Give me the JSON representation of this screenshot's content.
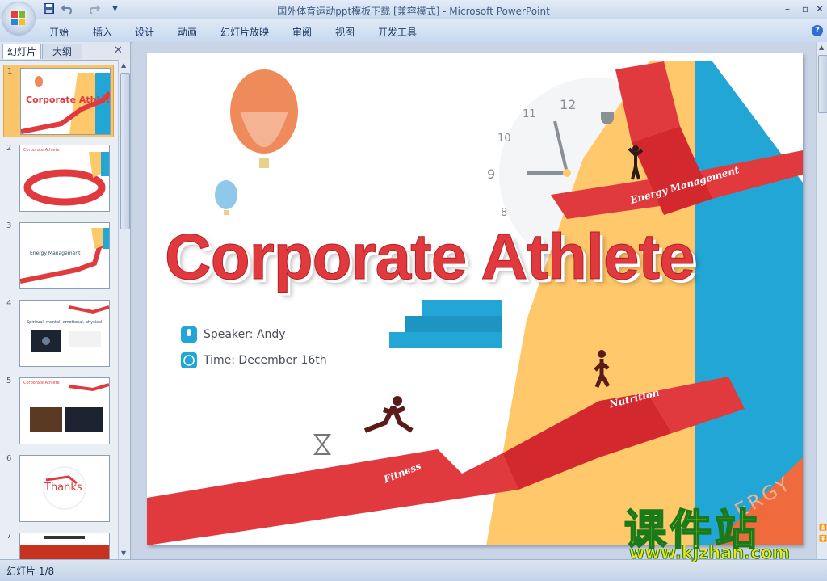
{
  "window": {
    "title": "国外体育运动ppt模板下载 [兼容模式] - Microsoft PowerPoint"
  },
  "quick_access": {
    "save_icon": "save-icon",
    "undo_icon": "undo-icon",
    "redo_icon": "redo-icon",
    "customize_icon": "chevron-down-icon"
  },
  "ribbon": {
    "tabs": [
      "开始",
      "插入",
      "设计",
      "动画",
      "幻灯片放映",
      "审阅",
      "视图",
      "开发工具"
    ],
    "help_label": "?"
  },
  "window_controls": {
    "minimize": "–",
    "restore": "▫",
    "close": "✕"
  },
  "panel": {
    "tabs": [
      "幻灯片",
      "大纲"
    ],
    "close_label": "✕",
    "slides": [
      {
        "number": "1",
        "caption": "Corporate Athlete"
      },
      {
        "number": "2",
        "caption": "Corporate Athlete"
      },
      {
        "number": "3",
        "caption": "Energy Management"
      },
      {
        "number": "4",
        "caption": "Spiritual, mental, emotional, physical"
      },
      {
        "number": "5",
        "caption": "Corporate Athlete"
      },
      {
        "number": "6",
        "caption": "Thanks"
      },
      {
        "number": "7",
        "caption": ""
      }
    ]
  },
  "slide": {
    "title": "Corporate Athlete",
    "speaker": "Speaker:  Andy",
    "time": "Time: December 16th",
    "clock_numbers": [
      "12",
      "11",
      "10",
      "9",
      "8"
    ],
    "labels": {
      "energy": "Energy Management",
      "nutrition": "Nutrition",
      "fitness": "Fitness",
      "corner": "ERGY"
    }
  },
  "status": {
    "text": "幻灯片 1/8"
  },
  "watermark": {
    "big": "课件站",
    "small": "www.kjzhan.com"
  },
  "colors": {
    "accent_red": "#e03a3e",
    "yellow": "#ffc96b",
    "blue": "#21a6d5"
  }
}
